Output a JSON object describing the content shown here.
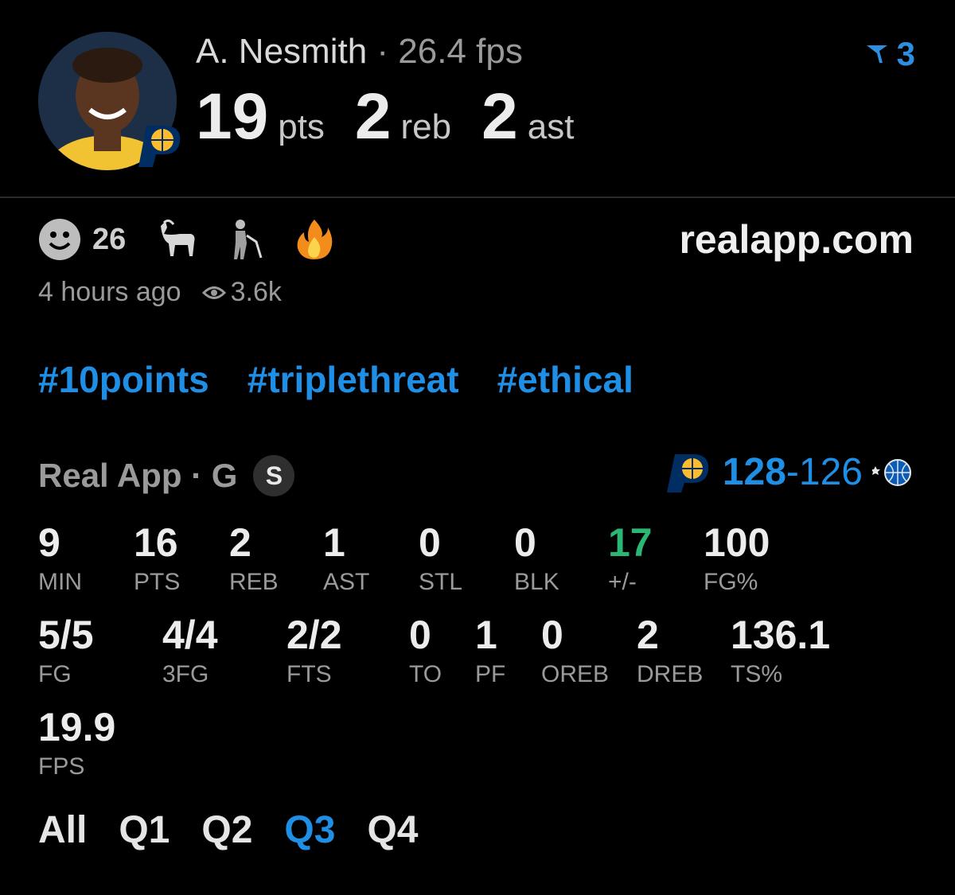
{
  "header": {
    "player_name": "A. Nesmith",
    "separator": "·",
    "fps_text": "26.4 fps",
    "pts": "19",
    "pts_label": "pts",
    "reb": "2",
    "reb_label": "reb",
    "ast": "2",
    "ast_label": "ast",
    "rank": "3"
  },
  "post": {
    "reaction_count": "26",
    "site": "realapp.com",
    "time_ago": "4 hours ago",
    "views": "3.6k",
    "tags": [
      "#10points",
      "#triplethreat",
      "#ethical"
    ]
  },
  "game": {
    "label": "Real App · G",
    "badge": "S",
    "score_home": "128",
    "score_dash": "-",
    "score_away": "126"
  },
  "stats_row1": [
    {
      "v": "9",
      "k": "MIN"
    },
    {
      "v": "16",
      "k": "PTS"
    },
    {
      "v": "2",
      "k": "REB"
    },
    {
      "v": "1",
      "k": "AST"
    },
    {
      "v": "0",
      "k": "STL"
    },
    {
      "v": "0",
      "k": "BLK"
    },
    {
      "v": "17",
      "k": "+/-"
    },
    {
      "v": "100",
      "k": "FG%"
    }
  ],
  "stats_row2": [
    {
      "v": "5/5",
      "k": "FG"
    },
    {
      "v": "4/4",
      "k": "3FG"
    },
    {
      "v": "2/2",
      "k": "FTS"
    },
    {
      "v": "0",
      "k": "TO"
    },
    {
      "v": "1",
      "k": "PF"
    },
    {
      "v": "0",
      "k": "OREB"
    },
    {
      "v": "2",
      "k": "DREB"
    },
    {
      "v": "136.1",
      "k": "TS%"
    }
  ],
  "stats_row3": [
    {
      "v": "19.9",
      "k": "FPS"
    }
  ],
  "quarters": {
    "all": "All",
    "q1": "Q1",
    "q2": "Q2",
    "q3": "Q3",
    "q4": "Q4",
    "active": "Q3"
  },
  "colors": {
    "accent": "#1f8fe6",
    "positive": "#2bb673",
    "background": "#000000"
  }
}
